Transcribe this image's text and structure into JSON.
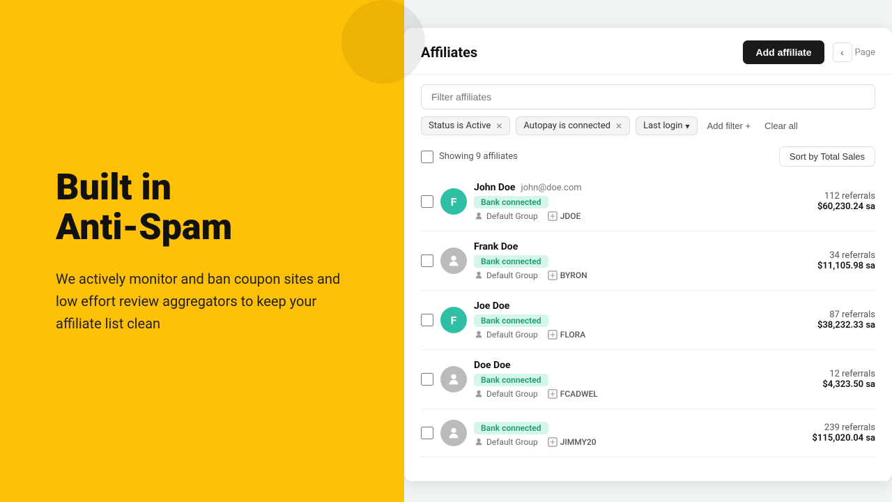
{
  "left": {
    "heading_line1": "Built in",
    "heading_line2": "Anti-Spam",
    "description": "We actively monitor and ban coupon sites and low effort review aggregators to keep your affiliate list clean"
  },
  "header": {
    "title": "Affiliates",
    "add_button": "Add affiliate",
    "page_label": "Page"
  },
  "search": {
    "placeholder": "Filter affiliates"
  },
  "filters": [
    {
      "label": "Status is Active",
      "removable": true
    },
    {
      "label": "Autopay is connected",
      "removable": true
    },
    {
      "label": "Last login",
      "dropdown": true
    }
  ],
  "add_filter": "Add filter +",
  "clear_all": "Clear all",
  "table": {
    "showing_label": "Showing 9 affiliates",
    "sort_button": "Sort by Total Sales"
  },
  "affiliates": [
    {
      "name": "John Doe",
      "email": "john@doe.com",
      "avatar_letter": "F",
      "avatar_color": "teal",
      "bank_connected": "Bank connected",
      "group": "Default Group",
      "code": "JDOE",
      "referrals": "112 referrals",
      "sales": "$60,230.24 sa"
    },
    {
      "name": "Frank Doe",
      "email": "",
      "avatar_letter": "",
      "avatar_color": "gray",
      "bank_connected": "Bank connected",
      "group": "Default Group",
      "code": "BYRON",
      "referrals": "34 referrals",
      "sales": "$11,105.98 sa"
    },
    {
      "name": "Joe Doe",
      "email": "",
      "avatar_letter": "F",
      "avatar_color": "teal",
      "bank_connected": "Bank connected",
      "group": "Default Group",
      "code": "FLORA",
      "referrals": "87 referrals",
      "sales": "$38,232.33 sa"
    },
    {
      "name": "Doe Doe",
      "email": "",
      "avatar_letter": "",
      "avatar_color": "gray",
      "bank_connected": "Bank connected",
      "group": "Default Group",
      "code": "FCADWEL",
      "referrals": "12 referrals",
      "sales": "$4,323.50 sa"
    },
    {
      "name": "",
      "email": "",
      "avatar_letter": "",
      "avatar_color": "gray",
      "bank_connected": "Bank connected",
      "group": "Default Group",
      "code": "JIMMY20",
      "referrals": "239 referrals",
      "sales": "$115,020.04 sa"
    }
  ]
}
